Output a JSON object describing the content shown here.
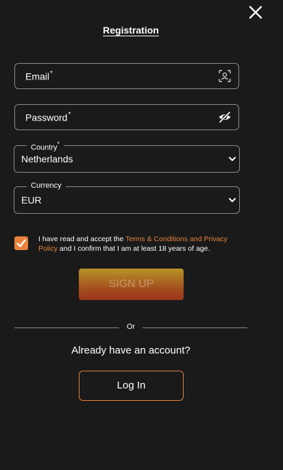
{
  "header": {
    "title": "Registration"
  },
  "form": {
    "email": {
      "label": "Email",
      "required_mark": "*",
      "icon": "face-scan-icon"
    },
    "password": {
      "label": "Password",
      "required_mark": "*",
      "icon": "eye-slash-icon"
    },
    "country": {
      "label": "Country",
      "required_mark": "*",
      "value": "Netherlands"
    },
    "currency": {
      "label": "Currency",
      "value": "EUR"
    },
    "terms": {
      "checked": true,
      "text_before": "I have read and accept the ",
      "link_text": "Terms & Conditions and Privacy Policy",
      "text_after": " and I confirm that I am at least 18 years of age."
    },
    "submit_label": "SIGN UP"
  },
  "divider": {
    "label": "Or"
  },
  "login": {
    "prompt": "Already have an account?",
    "button_label": "Log In"
  },
  "colors": {
    "background": "#1a1a1a",
    "accent": "#e8823d",
    "border": "#8c8c8c"
  }
}
